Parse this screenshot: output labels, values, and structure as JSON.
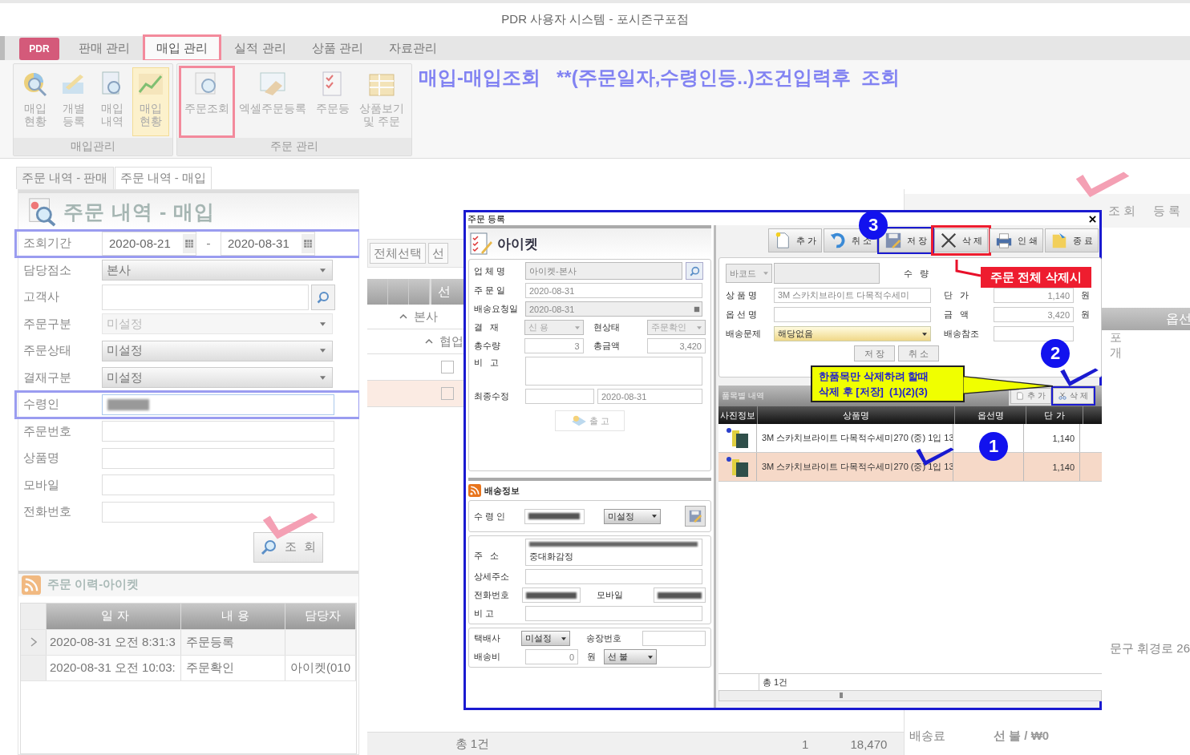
{
  "window": {
    "title": "PDR 사용자 시스템 - 포시즌구포점"
  },
  "menu": {
    "logo": "PDR",
    "tabs": [
      {
        "label": "판매 관리",
        "selected": false,
        "marked": false
      },
      {
        "label": "매입 관리",
        "selected": true,
        "marked": true
      },
      {
        "label": "실적 관리",
        "selected": false,
        "marked": false
      },
      {
        "label": "상품 관리",
        "selected": false,
        "marked": false
      },
      {
        "label": "자료관리",
        "selected": false,
        "marked": false
      }
    ]
  },
  "ribbon": {
    "groups": [
      {
        "title": "매입관리",
        "buttons": [
          {
            "kind": "chart-search",
            "lines": [
              "매입",
              "현황"
            ],
            "selected": false,
            "marked": false
          },
          {
            "kind": "notepad",
            "lines": [
              "개별",
              "등록"
            ],
            "selected": false,
            "marked": false
          },
          {
            "kind": "document-search",
            "lines": [
              "매입",
              "내역"
            ],
            "selected": false,
            "marked": false
          },
          {
            "kind": "line-chart",
            "lines": [
              "매입",
              "현황"
            ],
            "selected": true,
            "marked": false
          }
        ]
      },
      {
        "title": "주문 관리",
        "buttons": [
          {
            "kind": "report-search",
            "lines": [
              "주문조회"
            ],
            "selected": false,
            "marked": true
          },
          {
            "kind": "spreadsheet",
            "lines": [
              "엑셀주문등록"
            ],
            "selected": false,
            "marked": false
          },
          {
            "kind": "checklist",
            "lines": [
              "주문등"
            ],
            "selected": false,
            "marked": false
          },
          {
            "kind": "grid-box",
            "lines": [
              "상품보기",
              "및 주문"
            ],
            "selected": false,
            "marked": false
          }
        ]
      }
    ]
  },
  "instruction": "매입-매입조회   **(주문일자,수령인등..)조건입력후  조회",
  "doc_tabs": [
    {
      "label": "주문 내역 - 판매",
      "selected": false
    },
    {
      "label": "주문 내역 - 매입",
      "selected": true
    }
  ],
  "search_panel": {
    "title": "주문 내역 - 매입",
    "fields": [
      {
        "kind": "date_range",
        "label": "조회기간",
        "from": "2020-08-21",
        "separator": "-",
        "to": "2020-08-31",
        "highlighted": true
      },
      {
        "kind": "dropdown",
        "label": "담당점소",
        "value": "본사",
        "disabled": false,
        "highlighted": false
      },
      {
        "kind": "search",
        "label": "고객사",
        "highlighted": false
      },
      {
        "kind": "dropdown",
        "label": "주문구분",
        "value": "미설정",
        "disabled": true,
        "highlighted": false
      },
      {
        "kind": "dropdown",
        "label": "주문상태",
        "value": "미설정",
        "disabled": false,
        "highlighted": false
      },
      {
        "kind": "dropdown",
        "label": "결재구분",
        "value": "미설정",
        "disabled": false,
        "highlighted": false
      },
      {
        "kind": "redacted",
        "label": "수령인",
        "highlighted": true
      },
      {
        "kind": "text",
        "label": "주문번호",
        "highlighted": false
      },
      {
        "kind": "text",
        "label": "상품명",
        "highlighted": false
      },
      {
        "kind": "text",
        "label": "모바일",
        "highlighted": false
      },
      {
        "kind": "text",
        "label": "전화번호",
        "highlighted": false
      }
    ],
    "search_button": "조 회"
  },
  "history": {
    "title": "주문 이력-아이켓",
    "columns": [
      "일 자",
      "내 용",
      "담당자"
    ],
    "rows": [
      {
        "date": "2020-08-31 오전 8:31:3",
        "content": "주문등록",
        "selected": true
      },
      {
        "date": "2020-08-31 오전 10:03:",
        "content": "주문확인",
        "staff": "아이켓(010",
        "selected": false
      }
    ]
  },
  "order_list": {
    "buttons": [
      "전체선택",
      "선"
    ],
    "header": "선",
    "groups": [
      "본사",
      "협업"
    ],
    "rows": [
      {
        "selected": false
      },
      {
        "selected": true
      }
    ],
    "footer": {
      "count": "총 1건",
      "quantity": "1",
      "amount": "18,470"
    }
  },
  "detail_panel": {
    "toolbar": [
      "조 회",
      "등 록"
    ],
    "column": "옵선",
    "fragments": [
      "포",
      "개"
    ],
    "address": "문구 휘경로 26",
    "shipping_label": "배송료",
    "shipping_value": "선 불 / ₩0"
  },
  "dialog": {
    "title": "주문 등록",
    "company": "아이켓",
    "order": {
      "vendor_label": "업 체 명",
      "vendor": "아이켓-본사",
      "order_date_label": "주 문 일",
      "order_date": "2020-08-31",
      "request_label": "배송요청일",
      "request_date": "2020-08-31",
      "payment_label": "결   재",
      "payment": "신 용",
      "status_label": "현상태",
      "status": "주문확인",
      "qty_label": "총수량",
      "qty": "3",
      "total_label": "총금액",
      "total": "3,420",
      "memo_label": "비   고",
      "modified_label": "최종수정",
      "modified": "2020-08-31",
      "release_button": {
        "label": "출 고",
        "disabled": true
      }
    },
    "shipping": {
      "title": "배송정보",
      "recipient_label": "수 령 인",
      "recipient_option": "미설정",
      "address_label": "주   소",
      "address_line": "중대화감정",
      "detail_label": "상세주소",
      "phone_label": "전화번호",
      "mobile_label": "모바일",
      "memo_label": "비 고",
      "courier_label": "택배사",
      "courier": "미설정",
      "invoice_label": "송장번호",
      "fee_label": "배송비",
      "fee": "0",
      "fee_unit": "원",
      "fee_payment": "선 불"
    },
    "toolbar": [
      {
        "kind": "add",
        "label": "추 가",
        "marked": false,
        "highlighted": false
      },
      {
        "kind": "undo",
        "label": "취 소",
        "marked": false,
        "highlighted": false
      },
      {
        "kind": "save",
        "label": "저 장",
        "marked": false,
        "highlighted": true
      },
      {
        "kind": "delete",
        "label": "삭 제",
        "marked": true,
        "highlighted": false
      },
      {
        "kind": "print",
        "label": "인 쇄",
        "marked": false,
        "highlighted": false
      },
      {
        "kind": "exit",
        "label": "종 료",
        "marked": false,
        "highlighted": false
      }
    ],
    "item_form": {
      "barcode": "바코드",
      "qty_label": "수   량",
      "name_label": "상 품 명",
      "name": "3M 스카치브라이트 다목적수세미",
      "price_label": "단   가",
      "price": "1,140",
      "price_unit": "원",
      "option_label": "옵 선 명",
      "amount_label": "금   액",
      "amount": "3,420",
      "amount_unit": "원",
      "issue_label": "배송문제",
      "issue": "해당없음",
      "ref_label": "배송참조",
      "buttons": [
        "저 장",
        "취 소"
      ]
    },
    "items": {
      "title": "품목별 내역",
      "toolbar": [
        {
          "kind": "add",
          "label": "추 가",
          "highlighted": false
        },
        {
          "kind": "delete",
          "label": "삭 제",
          "highlighted": true
        }
      ],
      "columns": [
        "사진정보",
        "상품명",
        "옵선명",
        "단 가"
      ],
      "rows": [
        {
          "name": "3M 스카치브라이트 다목적수세미270 (중) 1입 13",
          "price": "1,140",
          "selected": false
        },
        {
          "name": "3M 스카치브라이트 다목적수세미270 (중) 1입 13",
          "price": "1,140",
          "selected": true
        }
      ],
      "footer": "총 1건"
    }
  },
  "annotations": [
    {
      "kind": "badge",
      "text": "3"
    },
    {
      "kind": "badge",
      "text": "2"
    },
    {
      "kind": "badge",
      "text": "1"
    },
    {
      "kind": "label",
      "text": "주문 전체 삭제시"
    },
    {
      "kind": "callout",
      "lines": [
        "한품목만 삭제하려 할때",
        "삭제 후 [저장]  (1)(2)(3)"
      ]
    }
  ]
}
